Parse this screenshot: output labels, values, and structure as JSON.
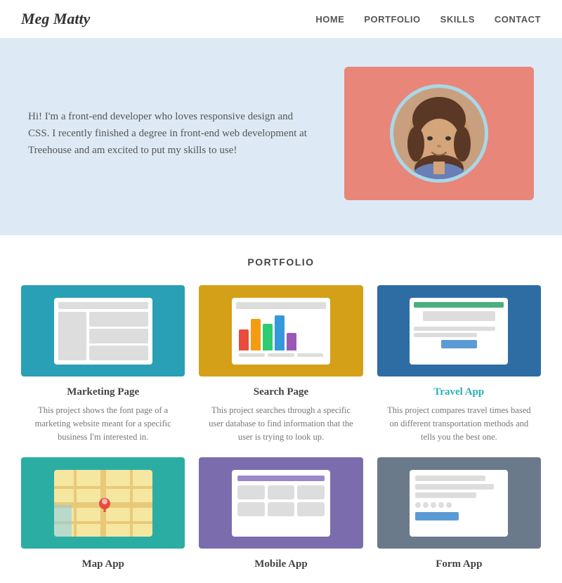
{
  "header": {
    "title": "Meg Matty",
    "nav": [
      {
        "label": "HOME",
        "id": "home"
      },
      {
        "label": "PORTFOLIO",
        "id": "portfolio"
      },
      {
        "label": "SKILLS",
        "id": "skills"
      },
      {
        "label": "CONTACT",
        "id": "contact"
      }
    ]
  },
  "hero": {
    "bio": "Hi! I'm a front-end developer who loves responsive design and CSS. I recently finished a degree in front-end web development at Treehouse and am excited to put my skills to use!"
  },
  "portfolio": {
    "section_title": "PORTFOLIO",
    "items": [
      {
        "id": "marketing-page",
        "title": "Marketing Page",
        "title_class": "normal",
        "description": "This project shows the font page of a marketing website meant for a specific business I'm interested in."
      },
      {
        "id": "search-page",
        "title": "Search Page",
        "title_class": "normal",
        "description": "This project searches through a specific user database to find information that the user is trying to look up."
      },
      {
        "id": "travel-app",
        "title": "Travel App",
        "title_class": "teal",
        "description": "This project compares travel times based on different transportation methods and tells you the best one."
      },
      {
        "id": "map-app",
        "title": "Map App",
        "title_class": "normal",
        "description": ""
      },
      {
        "id": "mobile-app",
        "title": "Mobile App",
        "title_class": "normal",
        "description": ""
      },
      {
        "id": "form-app",
        "title": "Form App",
        "title_class": "normal",
        "description": ""
      }
    ]
  }
}
